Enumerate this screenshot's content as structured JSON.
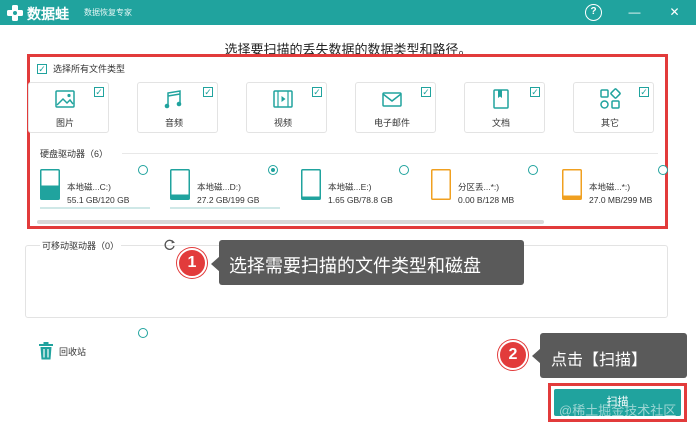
{
  "window": {
    "app_name": "数据蛙",
    "app_subtitle": "数据恢复专家",
    "help_glyph": "?",
    "minimize_glyph": "—",
    "close_glyph": "✕"
  },
  "heading": "选择要扫描的丢失数据的数据类型和路径。",
  "file_types": {
    "select_all_label": "选择所有文件类型",
    "select_all_checked": true,
    "items": [
      {
        "label": "图片",
        "icon": "image-icon",
        "checked": true
      },
      {
        "label": "音频",
        "icon": "audio-icon",
        "checked": true
      },
      {
        "label": "视频",
        "icon": "video-icon",
        "checked": true
      },
      {
        "label": "电子邮件",
        "icon": "email-icon",
        "checked": true
      },
      {
        "label": "文档",
        "icon": "document-icon",
        "checked": true
      },
      {
        "label": "其它",
        "icon": "other-icon",
        "checked": true
      }
    ]
  },
  "hard_drives": {
    "label": "硬盘驱动器（6）",
    "items": [
      {
        "name": "本地磁...C:)",
        "size": "55.1 GB/120 GB",
        "usage": 0.46,
        "selected": false,
        "color": "#20a39e"
      },
      {
        "name": "本地磁...D:)",
        "size": "27.2 GB/199 GB",
        "usage": 0.14,
        "selected": true,
        "color": "#20a39e"
      },
      {
        "name": "本地磁...E:)",
        "size": "1.65 GB/78.8 GB",
        "usage": 0.02,
        "selected": false,
        "color": "#20a39e"
      },
      {
        "name": "分区丢...*:)",
        "size": "0.00  B/128 MB",
        "usage": 0.0,
        "selected": false,
        "color": "#f0a020"
      },
      {
        "name": "本地磁...*:)",
        "size": "27.0 MB/299 MB",
        "usage": 0.09,
        "selected": false,
        "color": "#f0a020"
      }
    ]
  },
  "removable": {
    "label": "可移动驱动器（0）"
  },
  "recycle_bin": {
    "label": "回收站"
  },
  "scan_button": "扫描",
  "annotations": {
    "step1_number": "1",
    "step1_text": "选择需要扫描的文件类型和磁盘",
    "step2_number": "2",
    "step2_text": "点击【扫描】"
  },
  "watermark": "@稀土掘金技术社区",
  "colors": {
    "accent": "#20a39e",
    "highlight": "#e23b3b",
    "callout_bg": "#5a5a5a",
    "partition_orange": "#f0a020"
  }
}
